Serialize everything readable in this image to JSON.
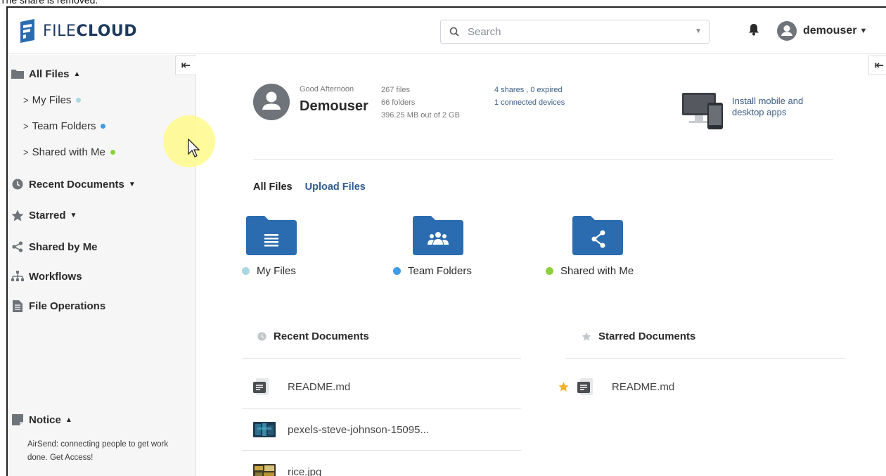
{
  "caption": "The share is removed.",
  "header": {
    "logo_text_thin": "FILE",
    "logo_text_bold": "CLOUD",
    "search_placeholder": "Search",
    "username": "demouser"
  },
  "sidebar": {
    "all_files": "All Files",
    "my_files": "My Files",
    "team_folders": "Team Folders",
    "shared_with_me": "Shared with Me",
    "recent_documents": "Recent Documents",
    "starred": "Starred",
    "shared_by_me": "Shared by Me",
    "workflows": "Workflows",
    "file_operations": "File Operations",
    "notice": "Notice",
    "notice_text": "AirSend: connecting people to get work done. Get Access!"
  },
  "profile": {
    "greeting": "Good Afternoon",
    "name": "Demouser",
    "files": "267 files",
    "folders": "66 folders",
    "quota": "396.25 MB out of 2 GB",
    "shares": "4 shares , 0 expired",
    "devices": "1 connected devices",
    "install": "Install mobile and desktop apps"
  },
  "tabs": {
    "all_files": "All Files",
    "upload_files": "Upload Files"
  },
  "folders": [
    {
      "label": "My Files",
      "dot_color": "#a9d8e0"
    },
    {
      "label": "Team Folders",
      "dot_color": "#3d9be9"
    },
    {
      "label": "Shared with Me",
      "dot_color": "#8cd13c"
    }
  ],
  "recent": {
    "title": "Recent Documents",
    "items": [
      "README.md",
      "pexels-steve-johnson-15095...",
      "rice.jpg"
    ]
  },
  "starred": {
    "title": "Starred Documents",
    "items": [
      "README.md"
    ]
  },
  "colors": {
    "brand": "#2b6cb0",
    "folder": "#2b6cb0",
    "star": "#f0b429",
    "link": "#2f5c8f"
  }
}
